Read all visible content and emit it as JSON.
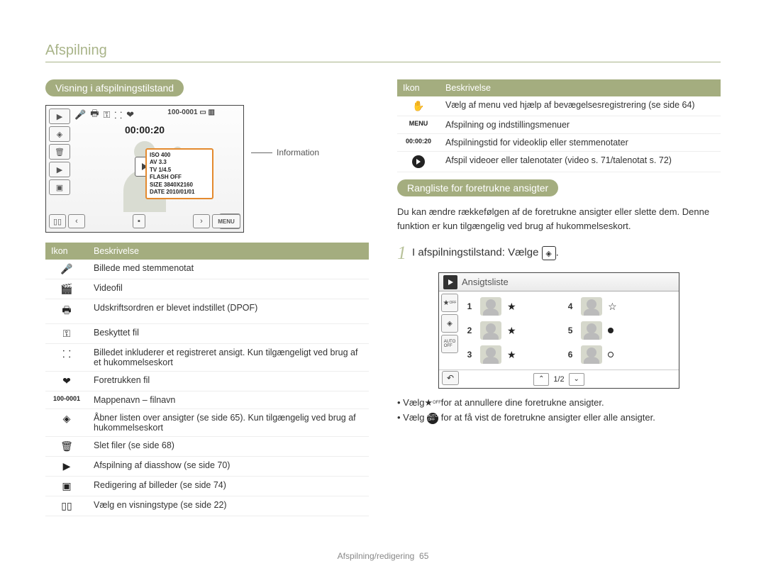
{
  "header": "Afspilning",
  "left": {
    "section_title": "Visning i afspilningstilstand",
    "camera": {
      "top_right": "100-0001",
      "time": "00:00:20",
      "info": {
        "iso": "ISO 400",
        "av": "AV 3.3",
        "tv": "TV 1/4.5",
        "flash": "FLASH OFF",
        "size": "SIZE 3840X2160",
        "date": "DATE 2010/01/01"
      },
      "callout": "Information",
      "bottom_menu": "MENU"
    },
    "table": {
      "h1": "Ikon",
      "h2": "Beskrivelse",
      "rows": [
        {
          "icon": "🎤",
          "name": "voice-memo-icon",
          "desc": "Billede med stemmenotat"
        },
        {
          "icon": "🎬",
          "name": "video-file-icon",
          "desc": "Videofil"
        },
        {
          "icon": "🖶",
          "name": "print-order-icon",
          "desc": "Udskriftsordren er blevet indstillet (DPOF)"
        },
        {
          "icon": "⚿",
          "name": "lock-icon",
          "desc": "Beskyttet fil"
        },
        {
          "icon": "⸬",
          "name": "face-registered-icon",
          "desc": "Billedet inkluderer et registreret ansigt. Kun tilgængeligt ved brug af et hukommelseskort"
        },
        {
          "icon": "❤",
          "name": "favorite-file-icon",
          "desc": "Foretrukken fil"
        },
        {
          "icon": "100-0001",
          "name": "folder-filename-label",
          "desc": "Mappenavn – filnavn"
        },
        {
          "icon": "◈",
          "name": "face-list-icon",
          "desc": "Åbner listen over ansigter (se side 65). Kun tilgængelig ved brug af hukommelseskort"
        },
        {
          "icon": "🗑",
          "name": "delete-files-icon",
          "desc": "Slet filer (se side 68)"
        },
        {
          "icon": "▶",
          "name": "slideshow-icon",
          "desc": "Afspilning af diasshow (se side 70)"
        },
        {
          "icon": "▣",
          "name": "edit-images-icon",
          "desc": "Redigering af billeder (se side 74)"
        },
        {
          "icon": "▯▯",
          "name": "display-type-icon",
          "desc": "Vælg en visningstype (se side 22)"
        }
      ]
    }
  },
  "right": {
    "table": {
      "h1": "Ikon",
      "h2": "Beskrivelse",
      "rows": [
        {
          "icon": "✋",
          "name": "motion-menu-icon",
          "desc": "Vælg af menu ved hjælp af bevægelsesregistrering (se side 64)"
        },
        {
          "icon": "MENU",
          "name": "menu-label-icon",
          "desc": "Afspilning og indstillingsmenuer"
        },
        {
          "icon": "00:00:20",
          "name": "playback-time-icon",
          "desc": "Afspilningstid for videoklip eller stemmenotater"
        },
        {
          "icon": "▶",
          "name": "play-video-icon",
          "desc": "Afspil videoer eller talenotater (video s. 71/talenotat s. 72)"
        }
      ]
    },
    "section_title": "Rangliste for foretrukne ansigter",
    "body": "Du kan ændre rækkefølgen af de foretrukne ansigter eller slette dem. Denne funktion er kun tilgængelig ved brug af hukommelseskort.",
    "step_num": "1",
    "step_text": "I afspilningstilstand: Vælge",
    "panel_title": "Ansigtsliste",
    "panel_rows": [
      "1",
      "2",
      "3",
      "4",
      "5",
      "6"
    ],
    "panel_page": "1/2",
    "bullets": [
      {
        "pre": "Vælg ",
        "icon": "star-off",
        "post": " for at annullere dine foretrukne ansigter."
      },
      {
        "pre": "Vælg ",
        "icon": "auto-off",
        "post": " for at få vist de foretrukne ansigter eller alle ansigter."
      }
    ]
  },
  "footer": {
    "label": "Afspilning/redigering",
    "page": "65"
  }
}
